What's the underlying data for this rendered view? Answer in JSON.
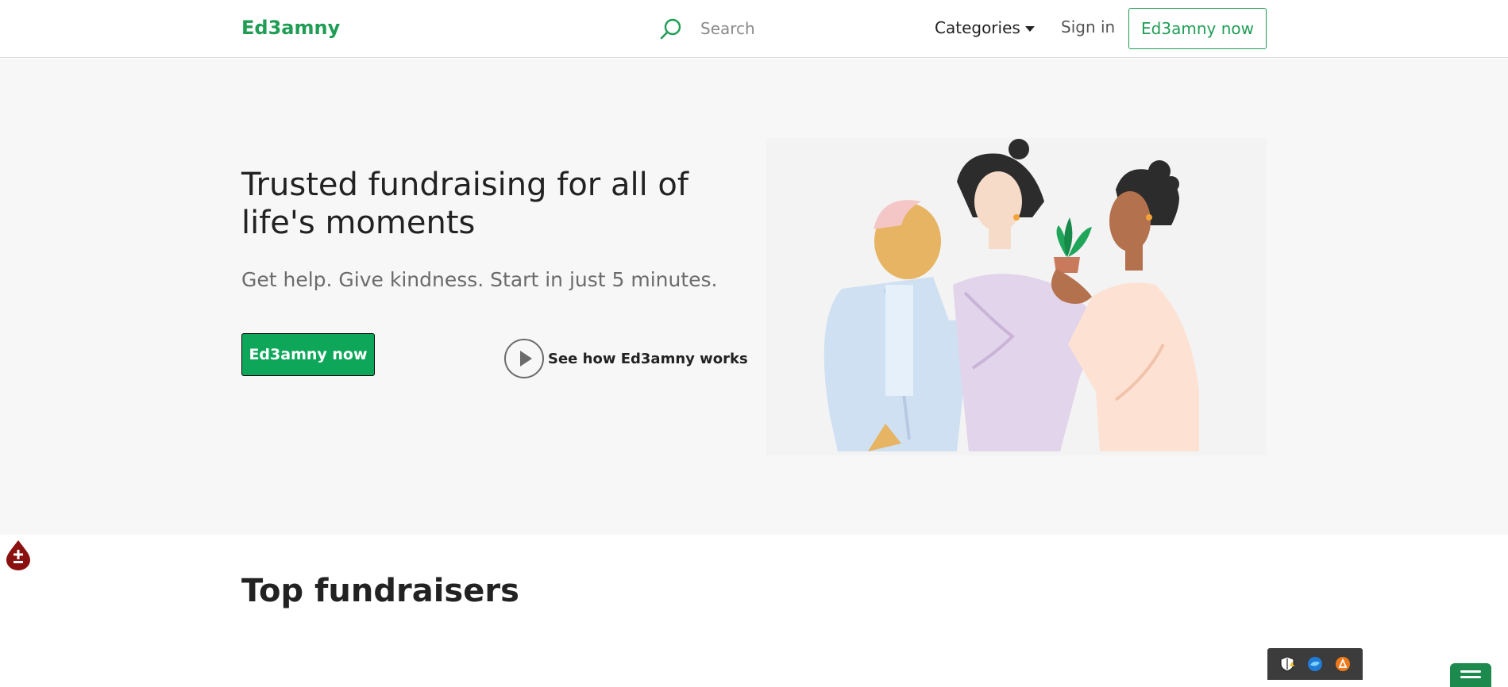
{
  "nav": {
    "brand": "Ed3amny",
    "search_placeholder": "Search",
    "categories_label": "Categories",
    "signin_label": "Sign in",
    "cta_label": "Ed3amny now"
  },
  "hero": {
    "title": "Trusted fundraising for all of life's moments",
    "subtitle": "Get help. Give kindness. Start in just 5 minutes.",
    "cta_label": "Ed3amny now",
    "how_it_works_label": "See how Ed3amny works"
  },
  "sections": {
    "top_fundraisers_title": "Top fundraisers"
  },
  "colors": {
    "brand_green": "#1f9d55",
    "cta_green": "#0ea75a",
    "hero_bg": "#f7f7f7",
    "badge_red": "#8b1010",
    "tray_bg": "#3c3c3c"
  },
  "icons": {
    "search": "search-icon",
    "play": "play-icon",
    "accessibility_badge": "plus-minus-icon",
    "tray": [
      "shield-icon",
      "browser-icon",
      "extension-icon"
    ],
    "chat": "menu-icon"
  }
}
